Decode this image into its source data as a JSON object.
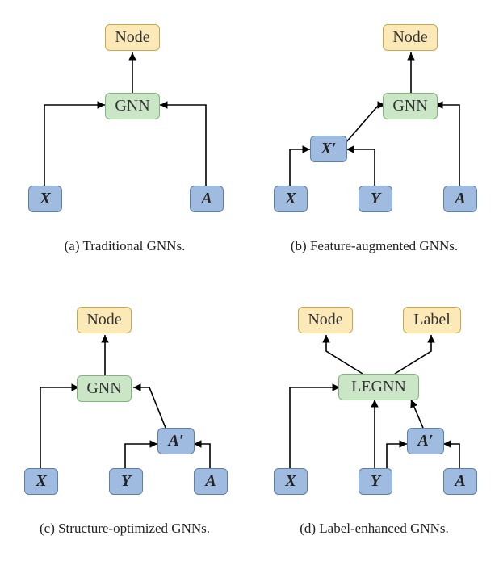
{
  "panels": {
    "a": {
      "caption": "(a) Traditional GNNs.",
      "output": "Node",
      "model": "GNN",
      "inputs": {
        "x": "X",
        "a": "A"
      }
    },
    "b": {
      "caption": "(b) Feature-augmented GNNs.",
      "output": "Node",
      "model": "GNN",
      "intermediate": {
        "xprime": "X′"
      },
      "inputs": {
        "x": "X",
        "y": "Y",
        "a": "A"
      }
    },
    "c": {
      "caption": "(c) Structure-optimized GNNs.",
      "output": "Node",
      "model": "GNN",
      "intermediate": {
        "aprime": "A′"
      },
      "inputs": {
        "x": "X",
        "y": "Y",
        "a": "A"
      }
    },
    "d": {
      "caption": "(d) Label-enhanced GNNs.",
      "outputs": {
        "node": "Node",
        "label": "Label"
      },
      "model": "LEGNN",
      "intermediate": {
        "aprime": "A′"
      },
      "inputs": {
        "x": "X",
        "y": "Y",
        "a": "A"
      }
    }
  },
  "chart_data": [
    {
      "type": "diagram",
      "title": "Traditional GNNs",
      "nodes": [
        {
          "id": "X",
          "kind": "input"
        },
        {
          "id": "A",
          "kind": "input"
        },
        {
          "id": "GNN",
          "kind": "model"
        },
        {
          "id": "Node",
          "kind": "output"
        }
      ],
      "edges": [
        {
          "from": "X",
          "to": "GNN"
        },
        {
          "from": "A",
          "to": "GNN"
        },
        {
          "from": "GNN",
          "to": "Node"
        }
      ]
    },
    {
      "type": "diagram",
      "title": "Feature-augmented GNNs",
      "nodes": [
        {
          "id": "X",
          "kind": "input"
        },
        {
          "id": "Y",
          "kind": "input"
        },
        {
          "id": "A",
          "kind": "input"
        },
        {
          "id": "X'",
          "kind": "intermediate"
        },
        {
          "id": "GNN",
          "kind": "model"
        },
        {
          "id": "Node",
          "kind": "output"
        }
      ],
      "edges": [
        {
          "from": "X",
          "to": "X'"
        },
        {
          "from": "Y",
          "to": "X'"
        },
        {
          "from": "X'",
          "to": "GNN"
        },
        {
          "from": "A",
          "to": "GNN"
        },
        {
          "from": "GNN",
          "to": "Node"
        }
      ]
    },
    {
      "type": "diagram",
      "title": "Structure-optimized GNNs",
      "nodes": [
        {
          "id": "X",
          "kind": "input"
        },
        {
          "id": "Y",
          "kind": "input"
        },
        {
          "id": "A",
          "kind": "input"
        },
        {
          "id": "A'",
          "kind": "intermediate"
        },
        {
          "id": "GNN",
          "kind": "model"
        },
        {
          "id": "Node",
          "kind": "output"
        }
      ],
      "edges": [
        {
          "from": "X",
          "to": "GNN"
        },
        {
          "from": "Y",
          "to": "A'"
        },
        {
          "from": "A",
          "to": "A'"
        },
        {
          "from": "A'",
          "to": "GNN"
        },
        {
          "from": "GNN",
          "to": "Node"
        }
      ]
    },
    {
      "type": "diagram",
      "title": "Label-enhanced GNNs",
      "nodes": [
        {
          "id": "X",
          "kind": "input"
        },
        {
          "id": "Y",
          "kind": "input"
        },
        {
          "id": "A",
          "kind": "input"
        },
        {
          "id": "A'",
          "kind": "intermediate"
        },
        {
          "id": "LEGNN",
          "kind": "model"
        },
        {
          "id": "Node",
          "kind": "output"
        },
        {
          "id": "Label",
          "kind": "output"
        }
      ],
      "edges": [
        {
          "from": "X",
          "to": "LEGNN"
        },
        {
          "from": "Y",
          "to": "LEGNN"
        },
        {
          "from": "Y",
          "to": "A'"
        },
        {
          "from": "A",
          "to": "A'"
        },
        {
          "from": "A'",
          "to": "LEGNN"
        },
        {
          "from": "LEGNN",
          "to": "Node"
        },
        {
          "from": "LEGNN",
          "to": "Label"
        }
      ]
    }
  ]
}
